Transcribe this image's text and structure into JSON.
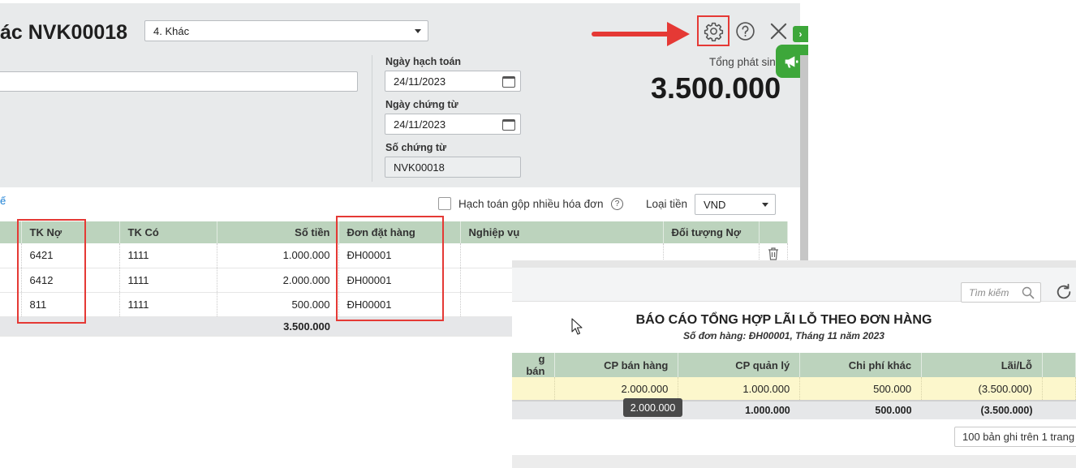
{
  "voucher": {
    "title": "ác NVK00018",
    "type_select": "4. Khác",
    "fields": {
      "posting_date_label": "Ngày hạch toán",
      "posting_date": "24/11/2023",
      "voucher_date_label": "Ngày chứng từ",
      "voucher_date": "24/11/2023",
      "voucher_no_label": "Số chứng từ",
      "voucher_no": "NVK00018"
    },
    "total_label": "Tổng phát sin",
    "total_value": "3.500.000",
    "link_fragment": "ế",
    "merge_invoices_label": "Hạch toán gộp nhiều hóa đơn",
    "help_glyph": "?",
    "currency_label": "Loại tiền",
    "currency": "VND",
    "side_tab_glyph": "›",
    "grid": {
      "headers": [
        "TK Nợ",
        "TK Có",
        "Số tiền",
        "Đơn đặt hàng",
        "Nghiệp vụ",
        "Đối tượng Nợ"
      ],
      "rows": [
        {
          "debit": "6421",
          "credit": "1111",
          "amount": "1.000.000",
          "order": "ĐH00001"
        },
        {
          "debit": "6412",
          "credit": "1111",
          "amount": "2.000.000",
          "order": "ĐH00001"
        },
        {
          "debit": "811",
          "credit": "1111",
          "amount": "500.000",
          "order": "ĐH00001"
        }
      ],
      "total_amount": "3.500.000"
    }
  },
  "report": {
    "search_placeholder": "Tìm kiếm",
    "title": "BÁO CÁO TỔNG HỢP LÃI LỖ THEO ĐƠN HÀNG",
    "subtitle": "Số đơn hàng: ĐH00001, Tháng 11 năm 2023",
    "headers": [
      "g bán",
      "CP bán hàng",
      "CP quản lý",
      "Chi phí khác",
      "Lãi/Lỗ"
    ],
    "row": [
      "",
      "2.000.000",
      "1.000.000",
      "500.000",
      "(3.500.000)"
    ],
    "totals": [
      "",
      "2.000.000",
      "1.000.000",
      "500.000",
      "(3.500.000)"
    ],
    "tooltip": "2.000.000",
    "pager": "100 bản ghi trên 1 trang"
  },
  "colors": {
    "accent_red": "#e53935",
    "header_green": "#bcd3bd",
    "highlight_row": "#fcf7cc",
    "brand_green": "#3da73a"
  }
}
